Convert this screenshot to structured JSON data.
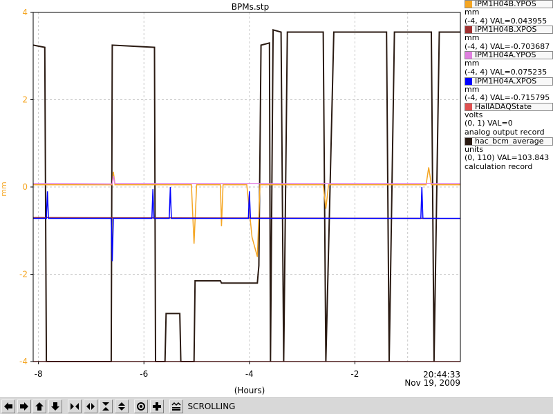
{
  "chart_data": {
    "type": "line",
    "title": "BPMs.stp",
    "xlabel": "(Hours)",
    "ylabel": "mm",
    "xlim": [
      -8.1,
      0
    ],
    "ylim": [
      -4,
      4
    ],
    "x_ticks": [
      "-8",
      "-6",
      "-4",
      "-2"
    ],
    "y_ticks": [
      "-4",
      "-2",
      "0",
      "2",
      "4"
    ],
    "time_label": "20:44:33",
    "date_label": "Nov 19, 2009",
    "grid": true,
    "legend_position": "right",
    "series": [
      {
        "name": "hac_bcm_average",
        "color": "#2a1a12",
        "points": [
          [
            -8.1,
            3.25
          ],
          [
            -7.88,
            3.2
          ],
          [
            -7.85,
            -4.0
          ],
          [
            -6.62,
            -4.0
          ],
          [
            -6.6,
            3.25
          ],
          [
            -5.8,
            3.2
          ],
          [
            -5.78,
            -4.0
          ],
          [
            -5.6,
            -4.0
          ],
          [
            -5.58,
            -2.9
          ],
          [
            -5.32,
            -2.9
          ],
          [
            -5.3,
            -4.0
          ],
          [
            -5.05,
            -4.0
          ],
          [
            -5.03,
            -2.15
          ],
          [
            -4.55,
            -2.15
          ],
          [
            -4.53,
            -2.2
          ],
          [
            -3.85,
            -2.2
          ],
          [
            -3.82,
            -1.8
          ],
          [
            -3.78,
            3.25
          ],
          [
            -3.62,
            3.3
          ],
          [
            -3.6,
            -4.0
          ],
          [
            -3.55,
            3.6
          ],
          [
            -3.4,
            3.55
          ],
          [
            -3.35,
            -4.0
          ],
          [
            -3.28,
            3.55
          ],
          [
            -2.6,
            3.55
          ],
          [
            -2.55,
            -4.0
          ],
          [
            -2.4,
            3.55
          ],
          [
            -1.4,
            3.55
          ],
          [
            -1.35,
            -4.0
          ],
          [
            -1.25,
            3.55
          ],
          [
            -0.55,
            3.55
          ],
          [
            -0.5,
            -4.0
          ],
          [
            -0.4,
            3.55
          ],
          [
            0,
            3.55
          ]
        ]
      },
      {
        "name": "HallADAQState",
        "color": "#e05050",
        "points": [
          [
            -8.1,
            -4.0
          ],
          [
            0,
            -4.0
          ]
        ]
      },
      {
        "name": "IPM1H04B.YPOS",
        "color": "#f5a623",
        "points": [
          [
            -8.1,
            0.05
          ],
          [
            -6.6,
            0.05
          ],
          [
            -6.58,
            0.35
          ],
          [
            -6.55,
            0.05
          ],
          [
            -5.1,
            0.05
          ],
          [
            -5.05,
            -1.3
          ],
          [
            -5.0,
            0.05
          ],
          [
            -4.55,
            0.05
          ],
          [
            -4.53,
            -0.9
          ],
          [
            -4.5,
            0.05
          ],
          [
            -4.05,
            0.05
          ],
          [
            -3.95,
            -1.15
          ],
          [
            -3.85,
            -1.6
          ],
          [
            -3.8,
            0.05
          ],
          [
            -2.6,
            0.05
          ],
          [
            -2.55,
            -0.5
          ],
          [
            -2.5,
            0.05
          ],
          [
            -0.65,
            0.05
          ],
          [
            -0.6,
            0.45
          ],
          [
            -0.55,
            0.05
          ],
          [
            0,
            0.05
          ]
        ]
      },
      {
        "name": "IPM1H04B.XPOS",
        "color": "#a03030",
        "points": [
          [
            -8.1,
            -0.7
          ],
          [
            0,
            -0.72
          ]
        ]
      },
      {
        "name": "IPM1H04A.YPOS",
        "color": "#e080e0",
        "points": [
          [
            -8.1,
            0.08
          ],
          [
            -6.6,
            0.07
          ],
          [
            -6.58,
            0.25
          ],
          [
            -6.55,
            0.08
          ],
          [
            0,
            0.08
          ]
        ]
      },
      {
        "name": "IPM1H04A.XPOS",
        "color": "#0000ff",
        "points": [
          [
            -8.1,
            -0.72
          ],
          [
            -7.85,
            -0.72
          ],
          [
            -7.83,
            -0.1
          ],
          [
            -7.81,
            -0.72
          ],
          [
            -6.62,
            -0.72
          ],
          [
            -6.6,
            -1.7
          ],
          [
            -6.58,
            -0.72
          ],
          [
            -5.85,
            -0.72
          ],
          [
            -5.83,
            -0.05
          ],
          [
            -5.81,
            -0.72
          ],
          [
            -5.52,
            -0.72
          ],
          [
            -5.5,
            0.0
          ],
          [
            -5.48,
            -0.72
          ],
          [
            -4.02,
            -0.72
          ],
          [
            -4.0,
            -0.1
          ],
          [
            -3.98,
            -0.72
          ],
          [
            -0.75,
            -0.72
          ],
          [
            -0.73,
            0.0
          ],
          [
            -0.71,
            -0.72
          ],
          [
            0,
            -0.72
          ]
        ]
      }
    ]
  },
  "legend": [
    {
      "name": "IPM1H04B.YPOS",
      "swatch": "#f5a623",
      "unit": "mm",
      "range_val": "(-4, 4) VAL=0.043955",
      "record": ""
    },
    {
      "name": "IPM1H04B.XPOS",
      "swatch": "#a03030",
      "unit": "mm",
      "range_val": "(-4, 4) VAL=-0.703687",
      "record": ""
    },
    {
      "name": "IPM1H04A.YPOS",
      "swatch": "#e080e0",
      "unit": "mm",
      "range_val": "(-4, 4) VAL=0.075235",
      "record": ""
    },
    {
      "name": "IPM1H04A.XPOS",
      "swatch": "#0000ff",
      "unit": "mm",
      "range_val": "(-4, 4) VAL=-0.715795",
      "record": ""
    },
    {
      "name": "HallADAQState",
      "swatch": "#e05050",
      "unit": "volts",
      "range_val": "(0, 1) VAL=0",
      "record": "analog output record"
    },
    {
      "name": "hac_bcm_average",
      "swatch": "#2a1a12",
      "unit": "units",
      "range_val": "(0, 110) VAL=103.843",
      "record": "calculation record"
    }
  ],
  "toolbar": {
    "status": "SCROLLING",
    "buttons": [
      "arrow-left-icon",
      "arrow-right-icon",
      "arrow-up-icon",
      "arrow-down-icon",
      "zoom-in-x-icon",
      "zoom-out-x-icon",
      "zoom-in-y-icon",
      "zoom-out-y-icon",
      "center-icon",
      "crosshair-icon",
      "scroll-icon"
    ]
  }
}
